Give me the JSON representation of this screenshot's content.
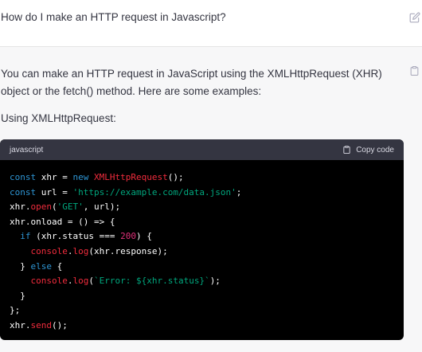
{
  "user_message": {
    "text": "How do I make an HTTP request in Javascript?",
    "edit_icon": "edit-icon"
  },
  "assistant": {
    "intro": "You can make an HTTP request in JavaScript using the XMLHttpRequest (XHR) object or the fetch() method. Here are some examples:",
    "using_label": "Using XMLHttpRequest:",
    "copy_icon": "clipboard-icon"
  },
  "code_block": {
    "language": "javascript",
    "copy_label": "Copy code",
    "lines": [
      [
        {
          "t": "const",
          "c": "kw"
        },
        {
          "t": " xhr = ",
          "c": "pl"
        },
        {
          "t": "new",
          "c": "kw"
        },
        {
          "t": " ",
          "c": "pl"
        },
        {
          "t": "XMLHttpRequest",
          "c": "cls"
        },
        {
          "t": "();",
          "c": "pl"
        }
      ],
      [
        {
          "t": "const",
          "c": "kw"
        },
        {
          "t": " url = ",
          "c": "pl"
        },
        {
          "t": "'https://example.com/data.json'",
          "c": "str"
        },
        {
          "t": ";",
          "c": "pl"
        }
      ],
      [
        {
          "t": "xhr.",
          "c": "pl"
        },
        {
          "t": "open",
          "c": "fn"
        },
        {
          "t": "(",
          "c": "pl"
        },
        {
          "t": "'GET'",
          "c": "str"
        },
        {
          "t": ", url);",
          "c": "pl"
        }
      ],
      [
        {
          "t": "xhr.onload = () => {",
          "c": "pl"
        }
      ],
      [
        {
          "t": "  ",
          "c": "pl"
        },
        {
          "t": "if",
          "c": "kw"
        },
        {
          "t": " (xhr.status === ",
          "c": "pl"
        },
        {
          "t": "200",
          "c": "num"
        },
        {
          "t": ") {",
          "c": "pl"
        }
      ],
      [
        {
          "t": "    ",
          "c": "pl"
        },
        {
          "t": "console",
          "c": "fn"
        },
        {
          "t": ".",
          "c": "pl"
        },
        {
          "t": "log",
          "c": "fn"
        },
        {
          "t": "(xhr.response);",
          "c": "pl"
        }
      ],
      [
        {
          "t": "  } ",
          "c": "pl"
        },
        {
          "t": "else",
          "c": "kw"
        },
        {
          "t": " {",
          "c": "pl"
        }
      ],
      [
        {
          "t": "    ",
          "c": "pl"
        },
        {
          "t": "console",
          "c": "fn"
        },
        {
          "t": ".",
          "c": "pl"
        },
        {
          "t": "log",
          "c": "fn"
        },
        {
          "t": "(",
          "c": "pl"
        },
        {
          "t": "`Error: ${xhr.status}`",
          "c": "str"
        },
        {
          "t": ");",
          "c": "pl"
        }
      ],
      [
        {
          "t": "  }",
          "c": "pl"
        }
      ],
      [
        {
          "t": "};",
          "c": "pl"
        }
      ],
      [
        {
          "t": "xhr.",
          "c": "pl"
        },
        {
          "t": "send",
          "c": "fn"
        },
        {
          "t": "();",
          "c": "pl"
        }
      ]
    ]
  },
  "colors": {
    "keyword": "#2e95d3",
    "class_or_method": "#f22c3d",
    "string": "#00a67d",
    "number": "#df3079",
    "code_bg": "#000000",
    "code_header_bg": "#343541"
  }
}
